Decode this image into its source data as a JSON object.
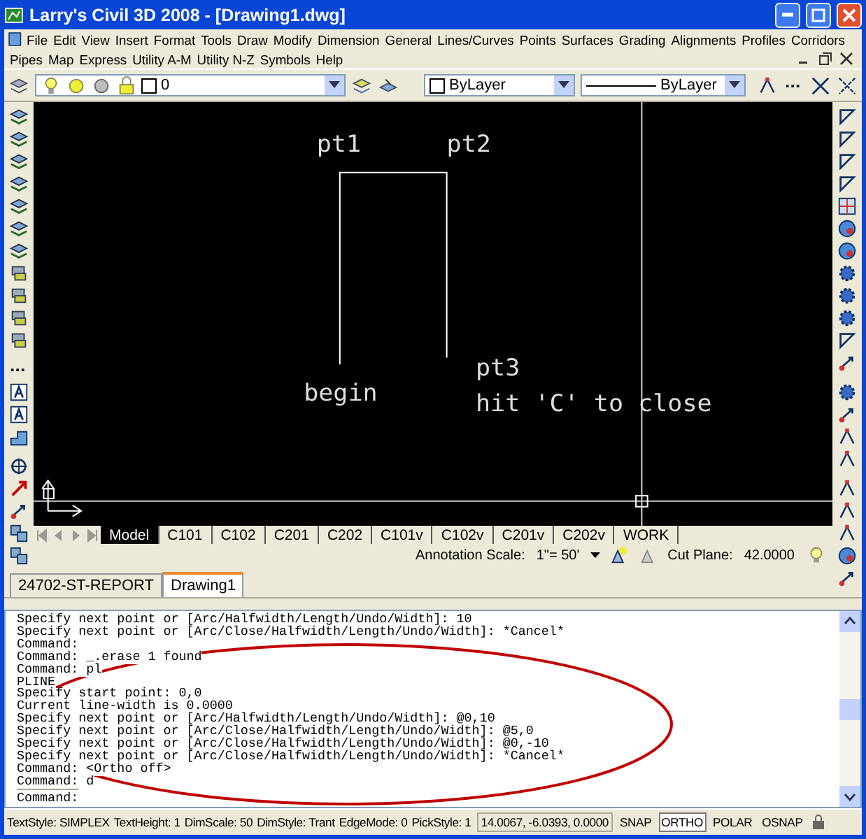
{
  "window": {
    "title": "Larry's Civil 3D 2008 - [Drawing1.dwg]"
  },
  "menu_rows": [
    [
      "File",
      "Edit",
      "View",
      "Insert",
      "Format",
      "Tools",
      "Draw",
      "Modify",
      "Dimension",
      "General",
      "Lines/Curves",
      "Points",
      "Surfaces",
      "Grading",
      "Alignments",
      "Profiles",
      "Corridors"
    ],
    [
      "Pipes",
      "Map",
      "Express",
      "Utility A-M",
      "Utility N-Z",
      "Symbols",
      "Help"
    ]
  ],
  "toolbar": {
    "layer": "0",
    "color_setting": "ByLayer",
    "linetype_setting": "ByLayer"
  },
  "canvas": {
    "labels": [
      "pt1",
      "pt2",
      "begin",
      "pt3",
      "hit 'C' to close"
    ]
  },
  "layout_tabs": [
    {
      "label": "Model",
      "selected": true
    },
    {
      "label": "C101",
      "selected": false
    },
    {
      "label": "C102",
      "selected": false
    },
    {
      "label": "C201",
      "selected": false
    },
    {
      "label": "C202",
      "selected": false
    },
    {
      "label": "C101v",
      "selected": false
    },
    {
      "label": "C102v",
      "selected": false
    },
    {
      "label": "C201v",
      "selected": false
    },
    {
      "label": "C202v",
      "selected": false
    },
    {
      "label": "WORK",
      "selected": false
    }
  ],
  "annotation": {
    "scale_label": "Annotation Scale:",
    "scale": "1\"= 50'",
    "cut_plane_label": "Cut Plane:",
    "cut_plane": "42.0000"
  },
  "document_tabs": [
    {
      "label": "24702-ST-REPORT",
      "selected": false
    },
    {
      "label": "Drawing1",
      "selected": true
    }
  ],
  "command_history": [
    "Specify next point or [Arc/Halfwidth/Length/Undo/Width]: 10",
    "Specify next point or [Arc/Close/Halfwidth/Length/Undo/Width]: *Cancel*",
    "Command:",
    "Command: _.erase 1 found",
    "Command: pl",
    "PLINE",
    "Specify start point: 0,0",
    "Current line-width is 0.0000",
    "Specify next point or [Arc/Halfwidth/Length/Undo/Width]: @0,10",
    "Specify next point or [Arc/Close/Halfwidth/Length/Undo/Width]: @5,0",
    "Specify next point or [Arc/Close/Halfwidth/Length/Undo/Width]: @0,-10",
    "Specify next point or [Arc/Close/Halfwidth/Length/Undo/Width]: *Cancel*",
    "Command: <Ortho off>",
    "Command: d"
  ],
  "command_prompt": "Command:",
  "status_bar": {
    "items": [
      "TextStyle: SIMPLEX",
      "TextHeight: 1",
      "DimScale: 50",
      "DimStyle: Trant",
      "EdgeMode: 0",
      "PickStyle: 1"
    ],
    "coordinates": "14.0067, -6.0393, 0.0000",
    "toggles": [
      {
        "label": "SNAP",
        "on": false
      },
      {
        "label": "ORTHO",
        "on": true
      },
      {
        "label": "POLAR",
        "on": false
      },
      {
        "label": "OSNAP",
        "on": false
      }
    ]
  }
}
